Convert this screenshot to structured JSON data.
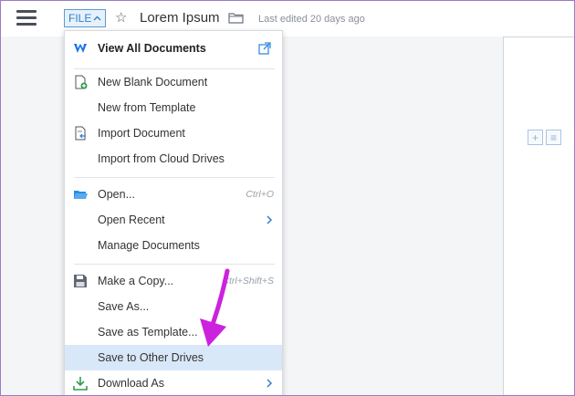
{
  "header": {
    "file_button": "FILE",
    "doc_title": "Lorem Ipsum",
    "last_edited": "Last edited 20 days ago"
  },
  "icons": {
    "menu": "hamburger-icon",
    "star": "star-icon",
    "folder": "folder-icon"
  },
  "menu": {
    "view_all": "View All Documents",
    "new_blank": "New Blank Document",
    "new_template": "New from Template",
    "import_doc": "Import Document",
    "import_cloud": "Import from Cloud Drives",
    "open": "Open...",
    "open_shortcut": "Ctrl+O",
    "open_recent": "Open Recent",
    "manage_docs": "Manage Documents",
    "make_copy": "Make a Copy...",
    "make_copy_shortcut": "Ctrl+Shift+S",
    "save_as": "Save As...",
    "save_template": "Save as Template...",
    "save_other": "Save to Other Drives",
    "download_as": "Download As"
  },
  "colors": {
    "accent": "#2f7fcf",
    "highlight": "#d9e8f8",
    "annotation_arrow": "#cc22dd"
  }
}
